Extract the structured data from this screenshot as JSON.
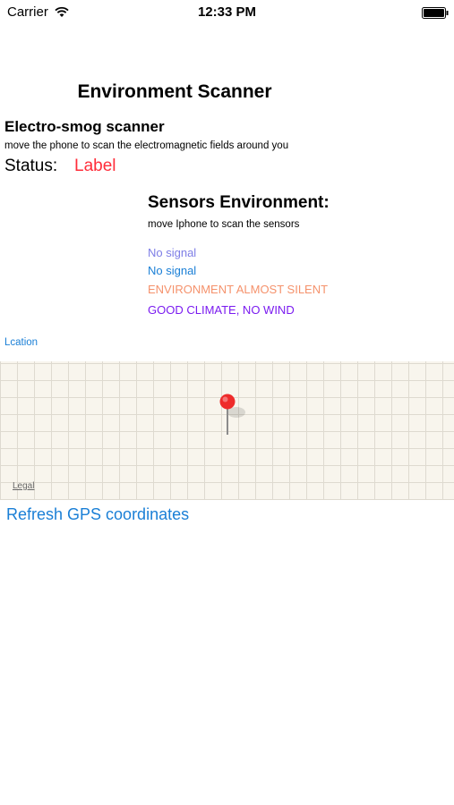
{
  "status_bar": {
    "carrier": "Carrier",
    "time": "12:33 PM",
    "icons": [
      "wifi-icon",
      "battery-icon"
    ]
  },
  "header": {
    "title": "Environment Scanner"
  },
  "electrosmog": {
    "title": "Electro-smog scanner",
    "subtitle": "move the phone to scan the electromagnetic fields around you",
    "status_label": "Status:",
    "status_value": "Label"
  },
  "sensors": {
    "title": "Sensors Environment:",
    "subtitle": "move Iphone to scan the sensors",
    "readings": [
      {
        "text": "No signal",
        "color": "#7e7ee6"
      },
      {
        "text": "No signal",
        "color": "#1a7fd6"
      },
      {
        "text": "ENVIRONMENT ALMOST SILENT",
        "color": "#f5926c"
      },
      {
        "text": "GOOD CLIMATE, NO WIND",
        "color": "#7a1bf0"
      }
    ]
  },
  "location": {
    "label": "Lcation",
    "map_legal": "Legal",
    "pin_color": "#ff2d2d"
  },
  "actions": {
    "refresh_gps": "Refresh GPS coordinates"
  },
  "colors": {
    "accent": "#1a7fd6",
    "status_red": "#ff2d3a"
  }
}
